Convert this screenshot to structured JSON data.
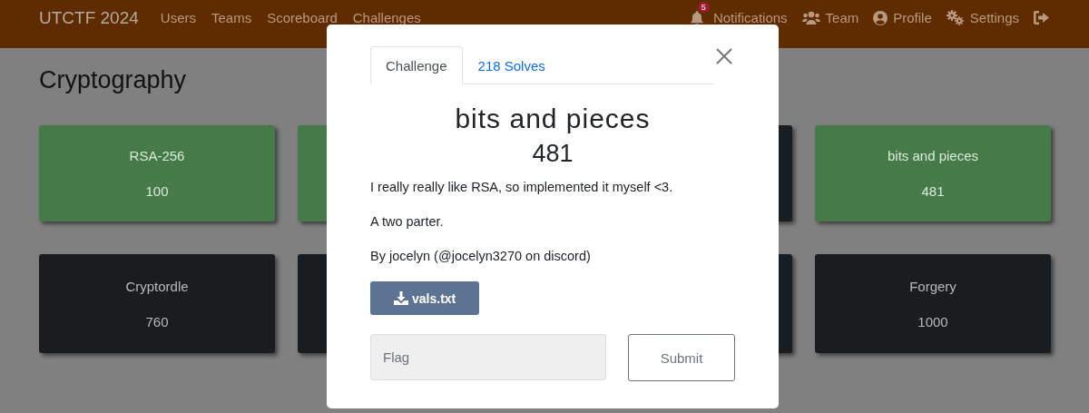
{
  "navbar": {
    "brand": "UTCTF 2024",
    "links": [
      "Users",
      "Teams",
      "Scoreboard",
      "Challenges"
    ],
    "right_links": [
      {
        "kind": "notifications",
        "label": "Notifications",
        "badge": "5"
      },
      {
        "kind": "team",
        "label": "Team"
      },
      {
        "kind": "profile",
        "label": "Profile"
      },
      {
        "kind": "settings",
        "label": "Settings"
      },
      {
        "kind": "logout"
      }
    ]
  },
  "page": {
    "heading": "Cryptography",
    "challenges": [
      {
        "name": "RSA-256",
        "value": "100",
        "solved": true
      },
      {
        "solved": true
      },
      {
        "solved": false
      },
      {
        "name": "bits and pieces",
        "value": "481",
        "solved": true
      },
      {
        "name": "Cryptordle",
        "value": "760",
        "solved": false
      },
      {
        "solved": false
      },
      {
        "solved": false
      },
      {
        "name": "Forgery",
        "value": "1000",
        "solved": false
      }
    ]
  },
  "modal": {
    "tabs": [
      {
        "label": "Challenge",
        "selected": true
      },
      {
        "label": "218 Solves",
        "selected": false
      }
    ],
    "name": "bits and pieces",
    "value": "481",
    "description": [
      "I really really like RSA, so implemented it myself <3.",
      "A two parter.",
      "By jocelyn (@jocelyn3270 on discord)"
    ],
    "files": [
      "vals.txt"
    ],
    "flag": {
      "placeholder": "Flag"
    },
    "submit": "Submit"
  }
}
